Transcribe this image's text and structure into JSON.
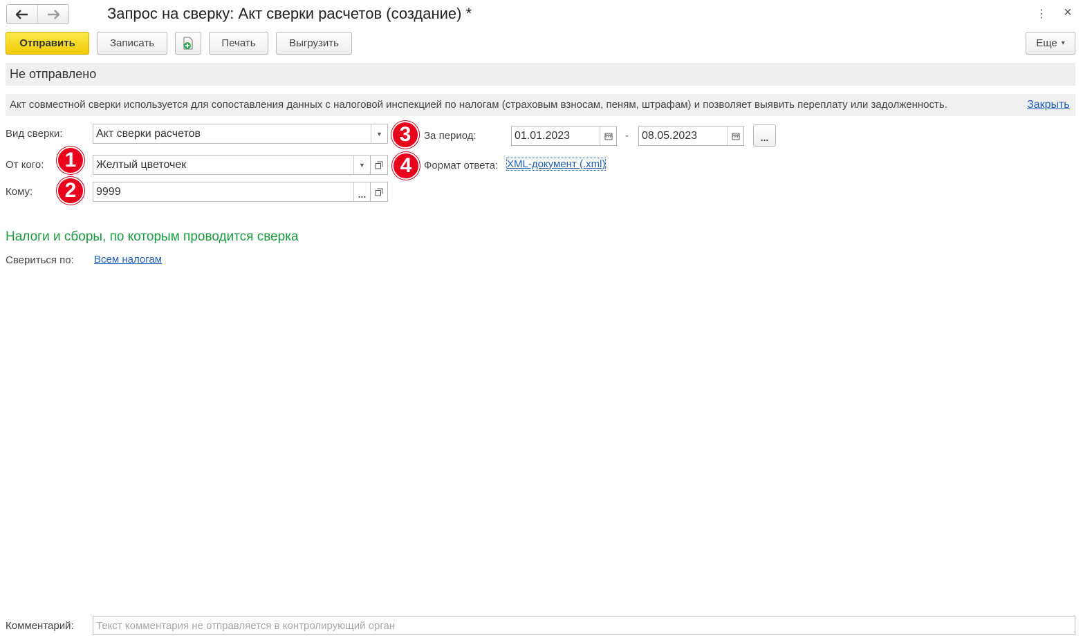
{
  "window": {
    "title": "Запрос на сверку: Акт сверки расчетов (создание) *",
    "more_icon": "⋮",
    "close_icon": "×"
  },
  "toolbar": {
    "send_label": "Отправить",
    "save_label": "Записать",
    "print_label": "Печать",
    "export_label": "Выгрузить",
    "more_label": "Еще",
    "more_chevron": "▾",
    "accent_color": "#f5d21c"
  },
  "status": {
    "text": "Не отправлено"
  },
  "info": {
    "text": "Акт совместной сверки используется для сопоставления данных с налоговой инспекцией по налогам (страховым взносам, пеням, штрафам) и позволяет выявить переплату или задолженность.",
    "close_link": "Закрыть"
  },
  "form": {
    "type_label": "Вид сверки:",
    "type_value": "Акт сверки расчетов",
    "from_label": "От кого:",
    "from_value": "Желтый цветочек",
    "to_label": "Кому:",
    "to_value": "9999",
    "period_label": "За период:",
    "period_from": "01.01.2023",
    "period_sep": "-",
    "period_to": "08.05.2023",
    "period_more": "...",
    "format_label": "Формат ответа:",
    "format_link": "XML-документ (.xml)",
    "select_more": "..."
  },
  "badges": [
    "1",
    "2",
    "3",
    "4"
  ],
  "taxes": {
    "title": "Налоги и сборы, по которым проводится сверка",
    "reconcile_label": "Свериться по:",
    "reconcile_link": "Всем налогам"
  },
  "comment": {
    "label": "Комментарий:",
    "placeholder": "Текст комментария не отправляется в контролирующий орган",
    "value": ""
  }
}
